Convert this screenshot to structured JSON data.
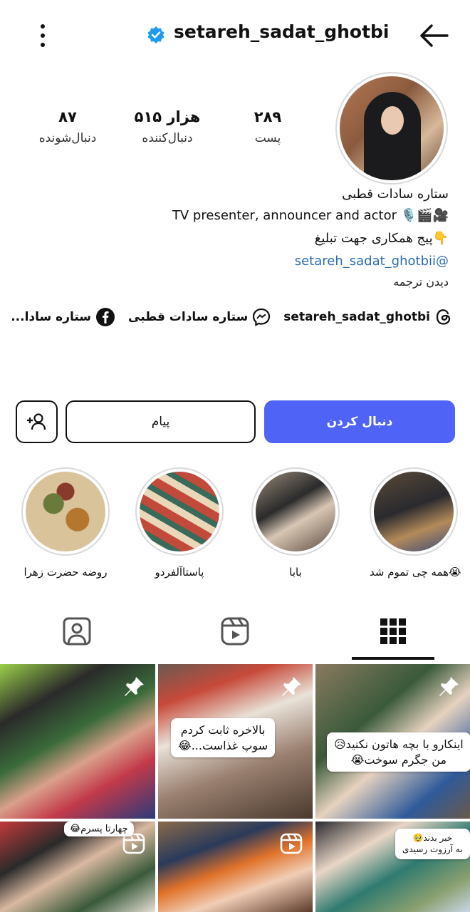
{
  "header": {
    "username": "setareh_sadat_ghotbi",
    "verified": true,
    "icons": [
      "more-vertical-icon",
      "verified-badge-icon",
      "back-arrow-icon"
    ]
  },
  "stats": {
    "posts": {
      "value": "۲۸۹",
      "label": "پست"
    },
    "followers": {
      "value": "۵۱۵ هزار",
      "label": "دنبال‌کننده"
    },
    "following": {
      "value": "۸۷",
      "label": "دنبال‌شونده"
    }
  },
  "bio": {
    "name": "ستاره سادات قطبی",
    "line1": "TV presenter, announcer and actor 🎙️🎬🎥",
    "line2": "پیج همکاری جهت تبلیغ👇",
    "mention": "setareh_sadat_ghotbii@",
    "translate": "دیدن ترجمه"
  },
  "links": {
    "threads": "setareh_sadat_ghotbi",
    "threads_icon": "threads-icon",
    "messenger": "ستاره سادات قطبی",
    "messenger_icon": "messenger-icon",
    "facebook": "ستاره سادا...",
    "facebook_icon": "facebook-icon"
  },
  "actions": {
    "follow": "دنبال کردن",
    "message": "پیام",
    "add_user_icon": "add-user-icon"
  },
  "highlights": [
    {
      "label": "همه چی تموم شد😭"
    },
    {
      "label": "بابا"
    },
    {
      "label": "پاستاآلفردو"
    },
    {
      "label": "روضه حضرت زهرا"
    }
  ],
  "tabs": [
    {
      "name": "grid",
      "icon": "grid-icon",
      "active": true
    },
    {
      "name": "reels",
      "icon": "reels-icon",
      "active": false
    },
    {
      "name": "tagged",
      "icon": "tagged-icon",
      "active": false
    }
  ],
  "posts": [
    {
      "type": "pinned",
      "caption": ""
    },
    {
      "type": "pinned",
      "caption": "بالاخره ثابت کردم\nسوپ غذاست...😂"
    },
    {
      "type": "pinned",
      "caption": "اینکارو با بچه هاتون نکنید😥\nمن جگرم سوخت😭"
    },
    {
      "type": "reel",
      "caption": "چهارتا پسرم😂"
    },
    {
      "type": "reel",
      "caption": ""
    },
    {
      "type": "reel",
      "caption": "خبر بدند🥹\nبه آرزوت رسیدی"
    }
  ],
  "colors": {
    "follow_button": "#4f63f6",
    "link": "#2b6cb0",
    "verified": "#1d9bf0"
  }
}
